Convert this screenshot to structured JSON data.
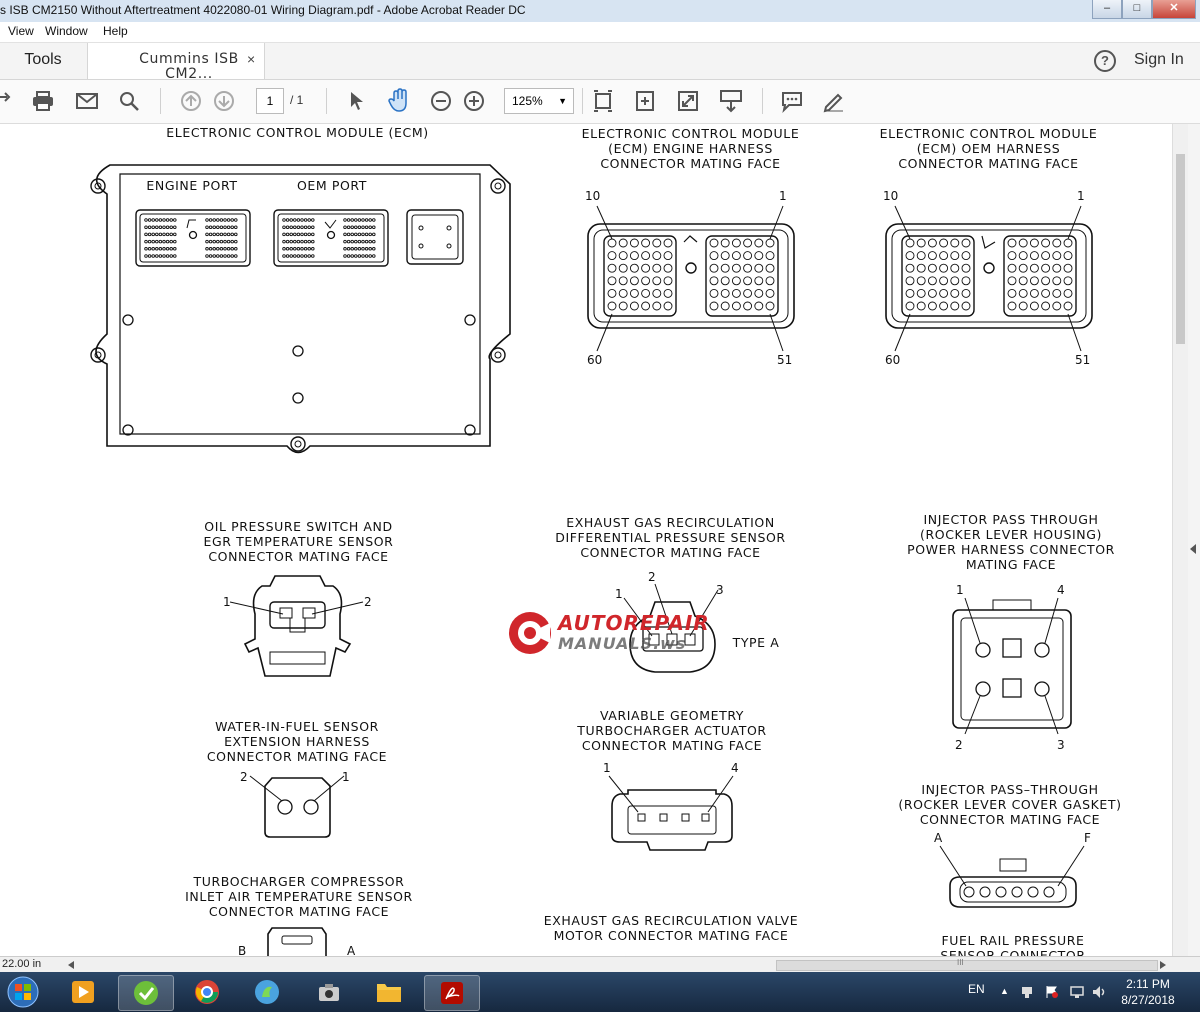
{
  "window": {
    "title": "s ISB CM2150 Without Aftertreatment 4022080-01 Wiring Diagram.pdf - Adobe Acrobat Reader DC",
    "min": "–",
    "max": "□",
    "close": "✕"
  },
  "menu": [
    "View",
    "Window",
    "Help"
  ],
  "tabs": {
    "tools": "Tools",
    "document": "Cummins ISB CM2...",
    "close": "×"
  },
  "header": {
    "help": "?",
    "signin": "Sign In"
  },
  "toolbar": {
    "page_current": "1",
    "page_total": "/ 1",
    "zoom": "125%"
  },
  "diagram": {
    "ecm": {
      "title": "ELECTRONIC  CONTROL  MODULE  (ECM)",
      "engine_port": "ENGINE  PORT",
      "oem_port": "OEM  PORT"
    },
    "engine_connector": {
      "title": "ELECTRONIC  CONTROL  MODULE\n(ECM)  ENGINE  HARNESS\nCONNECTOR  MATING  FACE",
      "p10": "10",
      "p1": "1",
      "p60": "60",
      "p51": "51"
    },
    "oem_connector": {
      "title": "ELECTRONIC  CONTROL  MODULE\n(ECM)  OEM  HARNESS\nCONNECTOR  MATING  FACE",
      "p10": "10",
      "p1": "1",
      "p60": "60",
      "p51": "51"
    },
    "oil_pressure": {
      "title": "OIL  PRESSURE  SWITCH  AND\nEGR  TEMPERATURE  SENSOR\nCONNECTOR  MATING  FACE",
      "p1": "1",
      "p2": "2"
    },
    "egr_diff": {
      "title": "EXHAUST  GAS  RECIRCULATION\nDIFFERENTIAL  PRESSURE  SENSOR\nCONNECTOR  MATING  FACE",
      "p1": "1",
      "p2": "2",
      "p3": "3",
      "type": "TYPE  A"
    },
    "injector_power": {
      "title": "INJECTOR  PASS  THROUGH\n(ROCKER  LEVER  HOUSING)\nPOWER  HARNESS  CONNECTOR\nMATING  FACE",
      "p1": "1",
      "p4": "4",
      "p2": "2",
      "p3": "3"
    },
    "wif": {
      "title": "WATER-IN-FUEL  SENSOR\nEXTENSION  HARNESS\nCONNECTOR  MATING  FACE",
      "p2": "2",
      "p1": "1"
    },
    "vgt": {
      "title": "VARIABLE  GEOMETRY\nTURBOCHARGER  ACTUATOR\nCONNECTOR  MATING  FACE",
      "p1": "1",
      "p4": "4"
    },
    "injector_gasket": {
      "title": "INJECTOR  PASS–THROUGH\n(ROCKER  LEVER  COVER  GASKET)\nCONNECTOR  MATING  FACE",
      "pA": "A",
      "pF": "F"
    },
    "turbo_temp": {
      "title": "TURBOCHARGER  COMPRESSOR\nINLET  AIR  TEMPERATURE  SENSOR\nCONNECTOR  MATING  FACE",
      "pB": "B",
      "pA": "A"
    },
    "egr_valve": {
      "title": "EXHAUST  GAS  RECIRCULATION  VALVE\nMOTOR  CONNECTOR  MATING  FACE"
    },
    "fuel_rail": {
      "title": "FUEL  RAIL  PRESSURE\nSENSOR  CONNECTOR"
    }
  },
  "watermark": {
    "line1": "AUTOREPAIR",
    "line2": "MANUALS.ws"
  },
  "status": {
    "size": "22.00 in",
    "grip": "III"
  },
  "taskbar": {
    "lang": "EN",
    "time": "2:11 PM",
    "date": "8/27/2018"
  },
  "colors": {
    "titlebar": "#d7e4f2",
    "taskbar": "#1f3655",
    "watermark": "#d0262b"
  }
}
